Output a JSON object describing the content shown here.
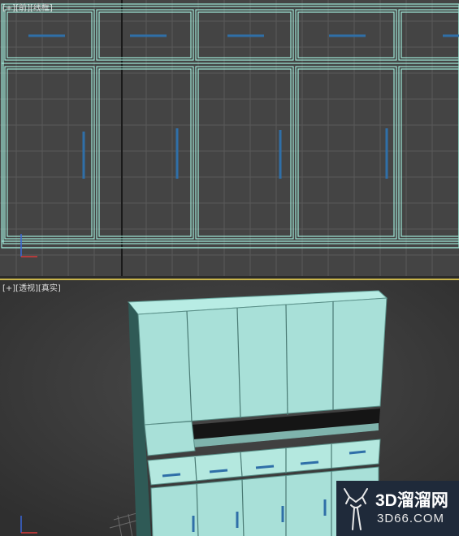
{
  "viewports": {
    "front": {
      "label_plus": "[+]",
      "label_view": "[前]",
      "label_mode": "[线框]"
    },
    "perspective": {
      "label_plus": "[+]",
      "label_view": "[透视]",
      "label_mode": "[真实]"
    }
  },
  "axis": {
    "z": "Z",
    "x": "X"
  },
  "watermark": {
    "title": "3D溜溜网",
    "subtitle": "3D66.COM"
  },
  "colors": {
    "viewport_bg": "#444444",
    "wire": "#9fe8d8",
    "cabinet": "#a8e0d8",
    "handle": "#2f6fa8",
    "active_border": "#c8b44a"
  }
}
